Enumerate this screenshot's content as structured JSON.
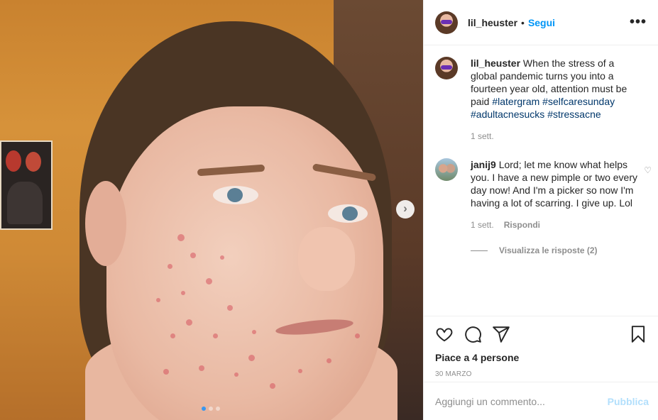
{
  "post": {
    "username": "lil_heuster",
    "separator": "•",
    "follow_label": "Segui",
    "more_icon": "more-horizontal-icon",
    "more_label": "•••",
    "next_icon": "chevron-right-icon",
    "next_label": "›",
    "image_count": 3,
    "current_image": 1
  },
  "caption": {
    "author": "lil_heuster",
    "text": "When the stress of a global pandemic turns you into a fourteen year old, attention must be paid",
    "hashtags": [
      "#latergram",
      "#selfcaresunday",
      "#adultacnesucks",
      "#stressacne"
    ],
    "time": "1 sett."
  },
  "comments": [
    {
      "author": "janij9",
      "text": "Lord; let me know what helps you. I have a new pimple or two every day now! And I'm a picker so now I'm having a lot of scarring. I give up. Lol",
      "time": "1 sett.",
      "reply_label": "Rispondi",
      "view_replies_label": "Visualizza le risposte (2)",
      "heart_icon": "heart-outline-icon",
      "heart_glyph": "♡"
    }
  ],
  "actions": {
    "like_icon": "heart-icon",
    "comment_icon": "comment-icon",
    "share_icon": "send-icon",
    "save_icon": "bookmark-icon",
    "likes_text": "Piace a 4 persone",
    "date": "30 MARZO"
  },
  "add_comment": {
    "placeholder": "Aggiungi un commento...",
    "publish_label": "Pubblica"
  },
  "colors": {
    "accent": "#0095f6",
    "hashtag": "#00376b",
    "publish_disabled": "#b2dffc",
    "muted": "#8e8e8e",
    "carousel_active_dot": "#3897f0"
  }
}
